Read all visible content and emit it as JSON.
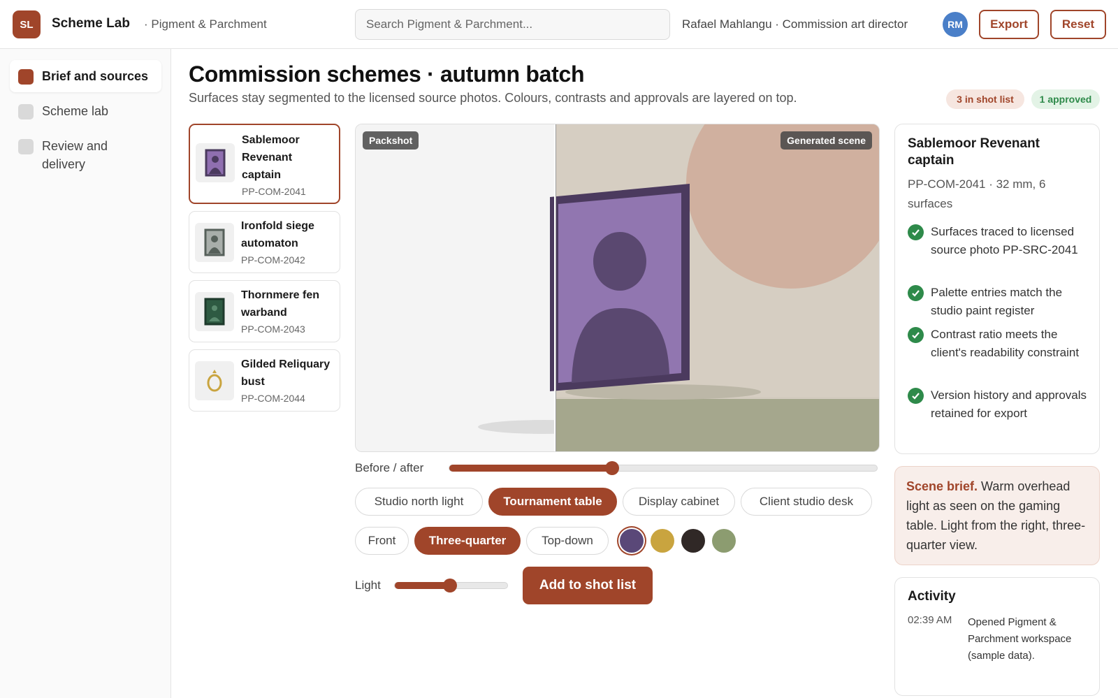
{
  "header": {
    "logo_initials": "SL",
    "app_name": "Scheme Lab",
    "workspace": "· Pigment & Parchment",
    "search_placeholder": "Search Pigment & Parchment...",
    "user": "Rafael Mahlangu · Commission art director",
    "avatar_initials": "RM",
    "export_label": "Export",
    "reset_label": "Reset"
  },
  "sidebar": {
    "items": [
      {
        "label": "Brief and sources",
        "active": true
      },
      {
        "label": "Scheme lab",
        "active": false
      },
      {
        "label": "Review and delivery",
        "active": false
      }
    ]
  },
  "main": {
    "title": "Commission schemes · autumn batch",
    "subtitle": "Surfaces stay segmented to the licensed source photos. Colours, contrasts and approvals are layered on top.",
    "badges": {
      "shot_list": "3 in shot list",
      "approved": "1 approved"
    }
  },
  "products": [
    {
      "name": "Sablemoor Revenant captain",
      "code": "PP-COM-2041",
      "selected": true
    },
    {
      "name": "Ironfold siege automaton",
      "code": "PP-COM-2042",
      "selected": false
    },
    {
      "name": "Thornmere fen warband",
      "code": "PP-COM-2043",
      "selected": false
    },
    {
      "name": "Gilded Reliquary bust",
      "code": "PP-COM-2044",
      "selected": false
    }
  ],
  "preview": {
    "packshot_label": "Packshot",
    "generated_label": "Generated scene"
  },
  "controls": {
    "before_after_label": "Before / after",
    "before_after_value": 0.38,
    "scenes": [
      {
        "label": "Studio north light",
        "active": false
      },
      {
        "label": "Tournament table",
        "active": true
      },
      {
        "label": "Display cabinet",
        "active": false
      },
      {
        "label": "Client studio desk",
        "active": false
      }
    ],
    "angles": [
      {
        "label": "Front",
        "active": false
      },
      {
        "label": "Three-quarter",
        "active": true
      },
      {
        "label": "Top-down",
        "active": false
      }
    ],
    "swatches": [
      {
        "color": "#5a4878",
        "selected": true
      },
      {
        "color": "#c9a43f",
        "selected": false
      },
      {
        "color": "#302826",
        "selected": false
      },
      {
        "color": "#8c9c70",
        "selected": false
      }
    ],
    "light_label": "Light",
    "light_value": 0.49,
    "add_button": "Add to shot list"
  },
  "detail": {
    "title": "Sablemoor Revenant captain",
    "meta": "PP-COM-2041 · 32 mm, 6 surfaces",
    "checks": [
      "Surfaces traced to licensed source photo PP-SRC-2041",
      "Palette entries match the studio paint register",
      "Contrast ratio meets the client's readability constraint",
      "Version history and approvals retained for export"
    ]
  },
  "brief": {
    "lead": "Scene brief.",
    "text": " Warm overhead light as seen on the gaming table. Light from the right, three-quarter view."
  },
  "activity": {
    "title": "Activity",
    "entries": [
      {
        "time": "02:39 AM",
        "text": "Opened Pigment & Parchment workspace (sample data)."
      }
    ]
  },
  "colors": {
    "accent": "#a0452a",
    "success": "#2e8a4a",
    "avatar": "#4a7fc8"
  }
}
